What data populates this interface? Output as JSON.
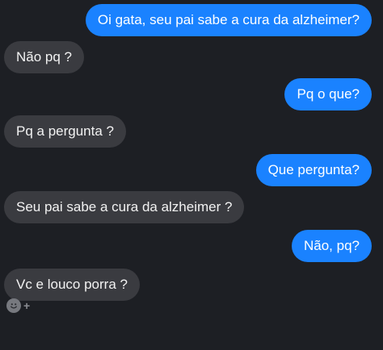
{
  "messages": [
    {
      "side": "out",
      "text": "Oi gata, seu pai sabe a cura da alzheimer?"
    },
    {
      "side": "in",
      "text": "Não pq ?"
    },
    {
      "side": "out",
      "text": "Pq o que?"
    },
    {
      "side": "in",
      "text": "Pq a pergunta ?"
    },
    {
      "side": "out",
      "text": "Que pergunta?"
    },
    {
      "side": "in",
      "text": "Seu pai sabe a cura da alzheimer ?"
    },
    {
      "side": "out",
      "text": "Não, pq?"
    },
    {
      "side": "in",
      "text": "Vc e louco porra ?"
    }
  ],
  "reaction": {
    "icon": "smiley-face-icon",
    "plus_label": "+"
  },
  "colors": {
    "background": "#1d1f24",
    "outgoing_bubble": "#1a82ff",
    "incoming_bubble": "#3a3b40"
  }
}
